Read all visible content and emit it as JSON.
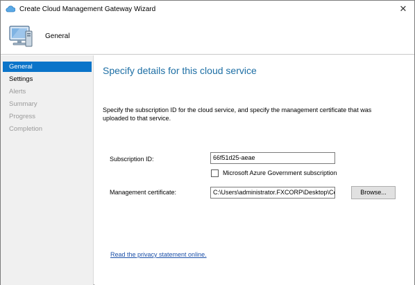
{
  "window": {
    "title": "Create Cloud Management Gateway Wizard",
    "title_icon": "cloud-icon",
    "close_glyph": "✕"
  },
  "header": {
    "title": "General",
    "icon": "computer-icon"
  },
  "sidebar": {
    "items": [
      {
        "label": "General",
        "state": "active"
      },
      {
        "label": "Settings",
        "state": "enabled"
      },
      {
        "label": "Alerts",
        "state": "disabled"
      },
      {
        "label": "Summary",
        "state": "disabled"
      },
      {
        "label": "Progress",
        "state": "disabled"
      },
      {
        "label": "Completion",
        "state": "disabled"
      }
    ]
  },
  "main": {
    "heading": "Specify details for this cloud service",
    "instructions": "Specify the subscription ID for the cloud service, and specify the management certificate that was uploaded to that service.",
    "subscription_label": "Subscription ID:",
    "subscription_value": "66f51d25-aeae",
    "gov_checkbox_label": "Microsoft Azure Government subscription",
    "gov_checked": false,
    "cert_label": "Management certificate:",
    "cert_value": "C:\\Users\\administrator.FXCORP\\Desktop\\Ce",
    "browse_label": "Browse...",
    "privacy_link": "Read the privacy statement online."
  },
  "colors": {
    "accent": "#0a74c9",
    "heading": "#1c6ea4",
    "link": "#1a4fa8",
    "sidebar_bg": "#f0f0f0"
  }
}
